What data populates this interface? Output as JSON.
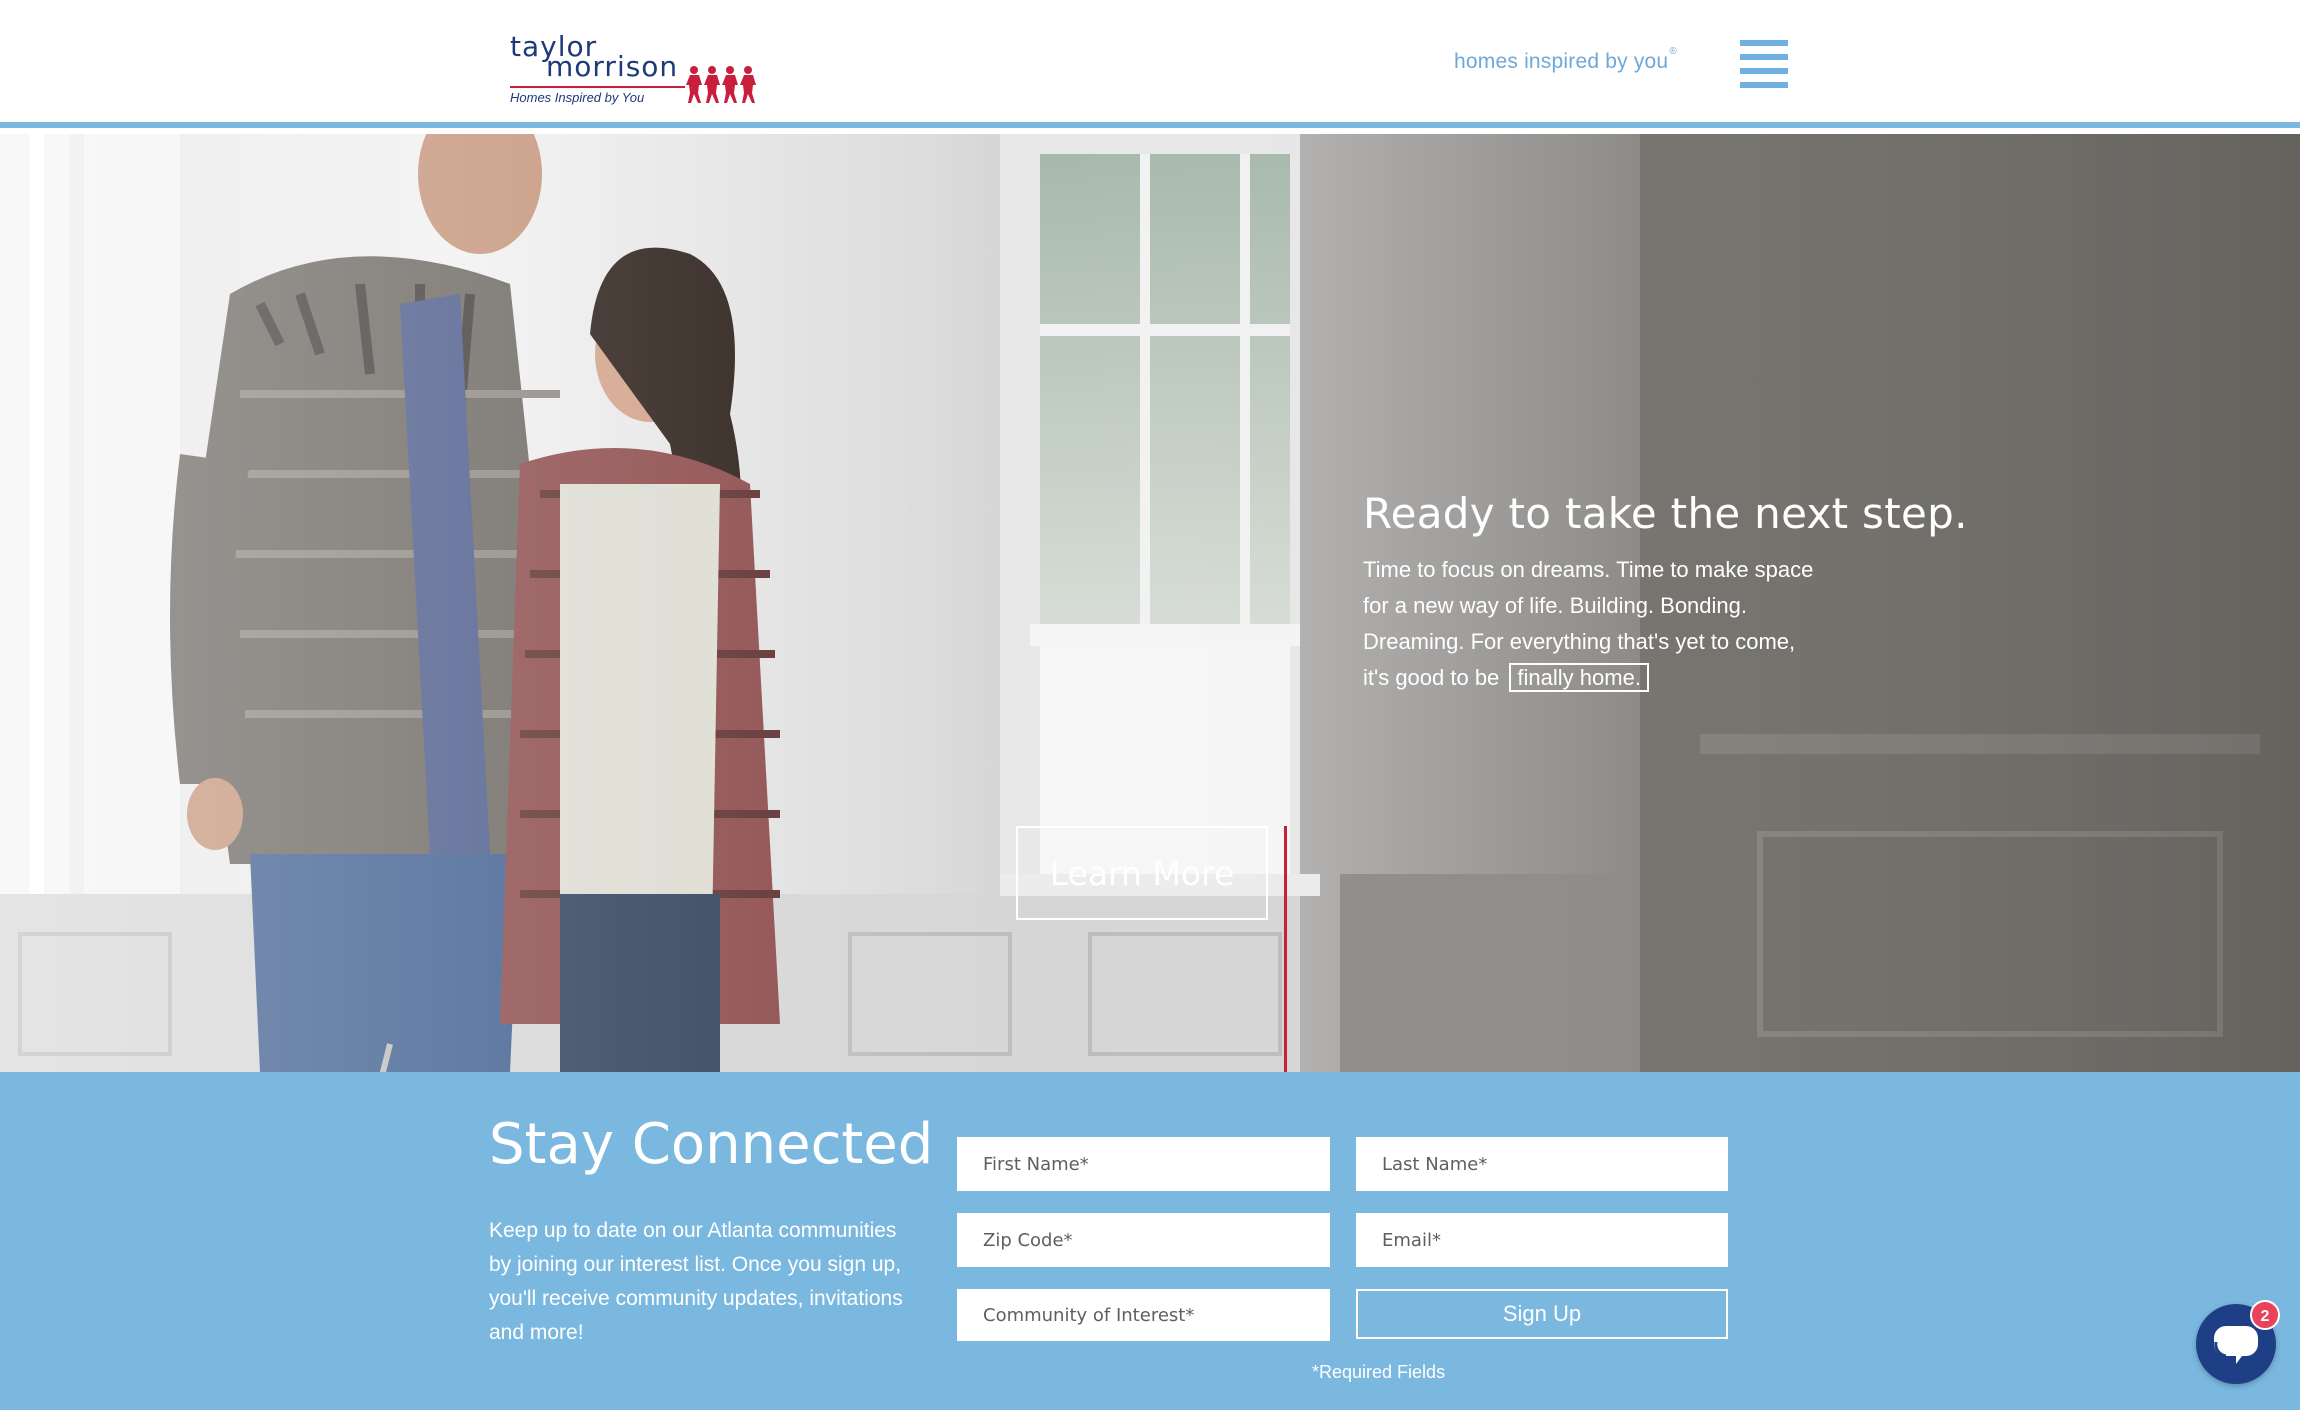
{
  "header": {
    "logo": {
      "line1": "taylor",
      "line2": "morrison",
      "tagline": "Homes Inspired by You"
    },
    "tagline": "homes inspired by you",
    "tagline_mark": "®"
  },
  "hero": {
    "title": "Ready to take the next step.",
    "body_lines": [
      "Time to focus on dreams. Time to make space",
      "for a new way of life. Building. Bonding.",
      "Dreaming. For everything that's yet to come,",
      "it's good to be"
    ],
    "link_label": "finally home.",
    "button_label": "Learn More"
  },
  "stay_connected": {
    "title": "Stay Connected",
    "description": "Keep up to date on our Atlanta communities by joining our interest list. Once you sign up, you'll receive community updates, invitations and more!",
    "fields": {
      "first_name": "First Name*",
      "last_name": "Last Name*",
      "zip_code": "Zip Code*",
      "email": "Email*",
      "community": "Community of Interest*"
    },
    "signup_label": "Sign Up",
    "required_note": "*Required Fields"
  },
  "chat": {
    "badge_count": "2"
  },
  "colors": {
    "brand_navy": "#1e3a78",
    "brand_red": "#c8203c",
    "accent_blue": "#7ab8e0",
    "chat_navy": "#1e3f86",
    "badge_red": "#e8435a"
  }
}
